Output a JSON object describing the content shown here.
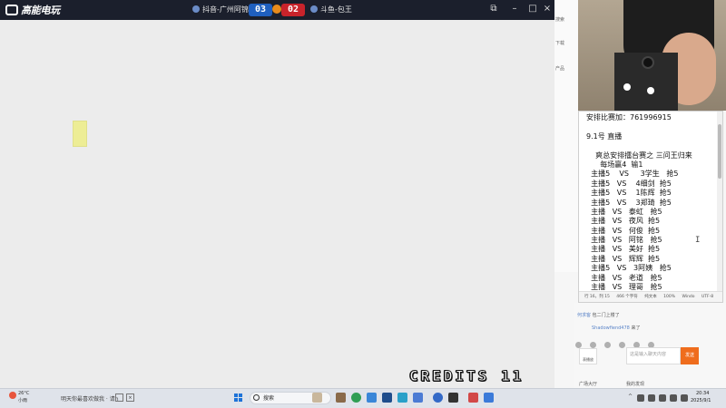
{
  "emulator": {
    "logo": "高能电玩",
    "player_left": "抖音-广州阿锦",
    "score_left": "03",
    "score_right": "02",
    "player_right": "斗鱼-包王",
    "credits": "CREDITS 11",
    "controls": {
      "restore": "⧉",
      "minimize": "–",
      "maximize": "□",
      "close": "×"
    }
  },
  "browser_strip": [
    "搜索",
    "下载",
    "",
    "产品",
    "",
    ""
  ],
  "notepad": {
    "lines": [
      "安排比赛加：761996915",
      "",
      "9.1号 直播",
      "",
      "    爽总安排擂台赛之 三问王归来",
      "      每场赢4  输1",
      "  主播5    VS     3学生   抢5",
      "  主播5   VS    4细剑  抢5",
      "  主播5   VS    1陈辉  抢5",
      "  主播5   VS    3郑琦  抢5",
      "  主播   VS   泰虹   抢5",
      "  主播   VS   夜风  抢5",
      "  主播   VS   何俊  抢5",
      "  主播   VS   阿铭   抢5",
      "  主播   VS   美好  抢5",
      "  主播   VS   辉辉  抢5",
      "  主播5   VS   3阿姨   抢5",
      "  主播   VS   老道   抢5",
      "  主播   VS   理哥   抢5"
    ],
    "status": [
      "行 16，列 15",
      "466 个字符",
      "纯文本",
      "100%",
      "Windo",
      "UTF-8"
    ]
  },
  "chat": {
    "row1_nick": "何求客",
    "row1_text": "包二门上楼了",
    "row2_nick": "Shadowfiend478",
    "row2_text": "来了",
    "avatar_label": "表播放",
    "input_placeholder": "这是输入聊天内容",
    "send_label": "发送",
    "footer_left": "广场大厅",
    "footer_right": "我的发现"
  },
  "taskbar": {
    "weather_temp": "26°C",
    "weather_desc": "小雨",
    "news": "明天你最喜欢做我 · 请h",
    "search_label": "搜索",
    "clock_time": "20:34",
    "clock_date": "2025/9/1"
  },
  "colors": {
    "title_bar": "#1b1f2c",
    "score_blue": "#1f5fbf",
    "score_red": "#c8232b",
    "send_orange": "#ef6d1d"
  }
}
